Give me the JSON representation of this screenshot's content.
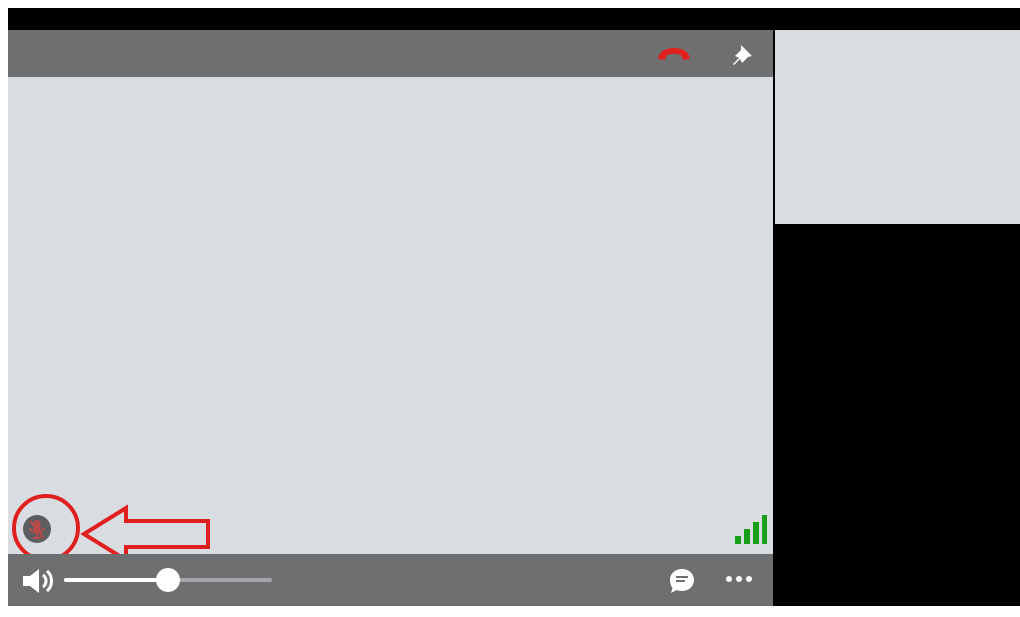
{
  "call": {
    "top_bar": {
      "hangup_icon": "phone-hangup-icon",
      "pin_icon": "pin-icon",
      "hangup_color": "#e0201f"
    },
    "participant": {
      "mic_status_icon": "microphone-muted-icon",
      "mic_status_color": "#b94a4a",
      "signal_icon": "signal-strength-icon",
      "signal_color": "#17a017",
      "annotation_color": "#e0201f"
    },
    "bottom_bar": {
      "volume_icon": "speaker-icon",
      "volume_level": 0.5,
      "chat_icon": "chat-bubble-icon",
      "more_icon": "more-options-icon"
    }
  }
}
